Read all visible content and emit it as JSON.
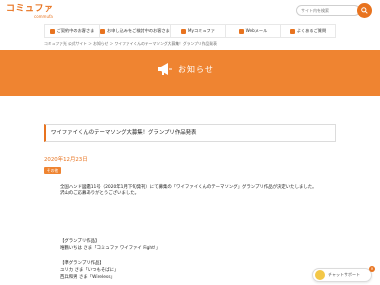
{
  "header": {
    "logo_main": "コミュファ",
    "logo_sub": "commufa",
    "search_placeholder": "サイト内を検索",
    "search_button_icon": "search-icon"
  },
  "gnav": [
    {
      "label": "ご契約中のお客さま",
      "icon": "user-icon"
    },
    {
      "label": "お申し込みをご検討中のお客さま",
      "icon": "home-icon"
    },
    {
      "label": "Myコミュファ",
      "icon": "my-icon"
    },
    {
      "label": "Webメール",
      "icon": "mail-icon"
    },
    {
      "label": "よくあるご質問",
      "icon": "question-icon"
    }
  ],
  "breadcrumb": "コミュファ光 公式サイト ＞ お知らせ ＞ ワイファイくんのテーマソング大募集！グランプリ作品発表",
  "hero": {
    "title": "お知らせ",
    "icon": "megaphone-icon"
  },
  "article": {
    "title": "ワイファイくんのテーマソング大募集！グランプリ作品発表",
    "date": "2020年12月23日",
    "badge": "その他",
    "lines": [
      "全国ハンド図鑑11号（2020年1月下旬発刊）にて募集の「ワイファイくんのテーマソング」グランプリ作品が決定いたしました。",
      "沢山のご応募ありがとうございました。",
      "【グランプリ作品】",
      "唯鶴いちは さま「コミュファ ワイファイ Fight!」",
      "【準グランプリ作品】",
      "ユリカ さま「いつもそばに」",
      "西兵和男 さま「Wireless」"
    ]
  },
  "support": {
    "label": "チャットサポート",
    "close": "×"
  },
  "colors": {
    "accent": "#e8731f",
    "hero_bg": "#ef8431"
  }
}
